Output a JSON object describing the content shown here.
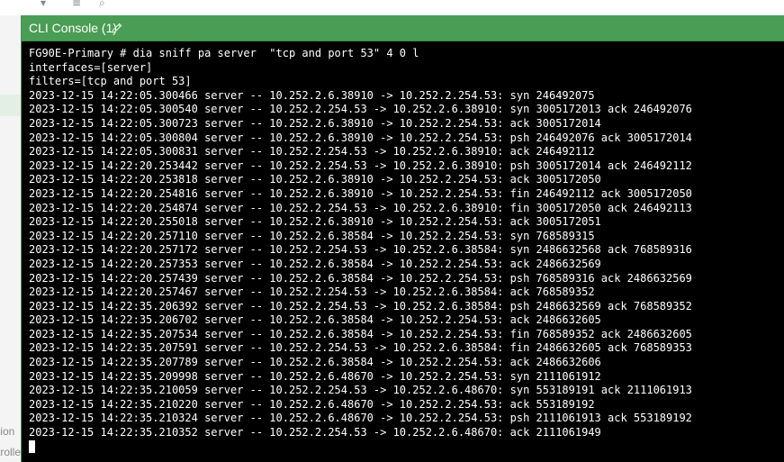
{
  "background": {
    "sidebar_labels": [
      "tion",
      "trolle"
    ]
  },
  "console": {
    "title": "CLI Console (1)",
    "header_color": "#4a9d54",
    "lines": [
      "FG90E-Primary # dia sniff pa server  \"tcp and port 53\" 4 0 l",
      "interfaces=[server]",
      "filters=[tcp and port 53]",
      "2023-12-15 14:22:05.300466 server -- 10.252.2.6.38910 -> 10.252.2.254.53: syn 246492075",
      "2023-12-15 14:22:05.300540 server -- 10.252.2.254.53 -> 10.252.2.6.38910: syn 3005172013 ack 246492076",
      "2023-12-15 14:22:05.300723 server -- 10.252.2.6.38910 -> 10.252.2.254.53: ack 3005172014",
      "2023-12-15 14:22:05.300804 server -- 10.252.2.6.38910 -> 10.252.2.254.53: psh 246492076 ack 3005172014",
      "2023-12-15 14:22:05.300831 server -- 10.252.2.254.53 -> 10.252.2.6.38910: ack 246492112",
      "2023-12-15 14:22:20.253442 server -- 10.252.2.254.53 -> 10.252.2.6.38910: psh 3005172014 ack 246492112",
      "2023-12-15 14:22:20.253818 server -- 10.252.2.6.38910 -> 10.252.2.254.53: ack 3005172050",
      "2023-12-15 14:22:20.254816 server -- 10.252.2.6.38910 -> 10.252.2.254.53: fin 246492112 ack 3005172050",
      "2023-12-15 14:22:20.254874 server -- 10.252.2.254.53 -> 10.252.2.6.38910: fin 3005172050 ack 246492113",
      "2023-12-15 14:22:20.255018 server -- 10.252.2.6.38910 -> 10.252.2.254.53: ack 3005172051",
      "2023-12-15 14:22:20.257110 server -- 10.252.2.6.38584 -> 10.252.2.254.53: syn 768589315",
      "2023-12-15 14:22:20.257172 server -- 10.252.2.254.53 -> 10.252.2.6.38584: syn 2486632568 ack 768589316",
      "2023-12-15 14:22:20.257353 server -- 10.252.2.6.38584 -> 10.252.2.254.53: ack 2486632569",
      "2023-12-15 14:22:20.257439 server -- 10.252.2.6.38584 -> 10.252.2.254.53: psh 768589316 ack 2486632569",
      "2023-12-15 14:22:20.257467 server -- 10.252.2.254.53 -> 10.252.2.6.38584: ack 768589352",
      "2023-12-15 14:22:35.206392 server -- 10.252.2.254.53 -> 10.252.2.6.38584: psh 2486632569 ack 768589352",
      "2023-12-15 14:22:35.206702 server -- 10.252.2.6.38584 -> 10.252.2.254.53: ack 2486632605",
      "2023-12-15 14:22:35.207534 server -- 10.252.2.6.38584 -> 10.252.2.254.53: fin 768589352 ack 2486632605",
      "2023-12-15 14:22:35.207591 server -- 10.252.2.254.53 -> 10.252.2.6.38584: fin 2486632605 ack 768589353",
      "2023-12-15 14:22:35.207789 server -- 10.252.2.6.38584 -> 10.252.2.254.53: ack 2486632606",
      "2023-12-15 14:22:35.209998 server -- 10.252.2.6.48670 -> 10.252.2.254.53: syn 2111061912",
      "2023-12-15 14:22:35.210059 server -- 10.252.2.254.53 -> 10.252.2.6.48670: syn 553189191 ack 2111061913",
      "2023-12-15 14:22:35.210220 server -- 10.252.2.6.48670 -> 10.252.2.254.53: ack 553189192",
      "2023-12-15 14:22:35.210324 server -- 10.252.2.6.48670 -> 10.252.2.254.53: psh 2111061913 ack 553189192",
      "2023-12-15 14:22:35.210352 server -- 10.252.2.254.53 -> 10.252.2.6.48670: ack 2111061949"
    ]
  }
}
